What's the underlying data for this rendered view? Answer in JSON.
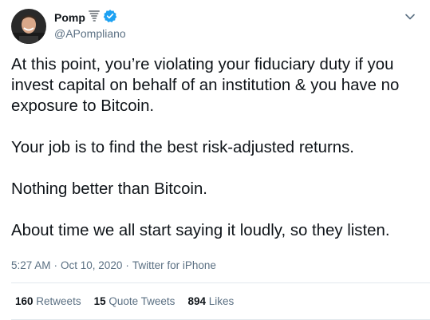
{
  "author": {
    "display_name": "Pomp",
    "handle": "@APompliano",
    "verified": true,
    "emoji_icon": "tornado-icon"
  },
  "tweet": {
    "paragraphs": [
      "At this point, you’re violating your fiduciary duty if you invest capital on behalf of an institution & you have no exposure to Bitcoin.",
      "Your job is to find the best risk-adjusted returns.",
      "Nothing better than Bitcoin.",
      "About time we all start saying it loudly, so they listen."
    ],
    "time": "5:27 AM",
    "date": "Oct 10, 2020",
    "source": "Twitter for iPhone",
    "separator": "·"
  },
  "stats": {
    "retweets_count": "160",
    "retweets_label": "Retweets",
    "quotes_count": "15",
    "quotes_label": "Quote Tweets",
    "likes_count": "894",
    "likes_label": "Likes"
  },
  "colors": {
    "text": "#0f1419",
    "secondary": "#5b7083",
    "verified": "#1da1f2",
    "divider": "#e1e8ed"
  }
}
